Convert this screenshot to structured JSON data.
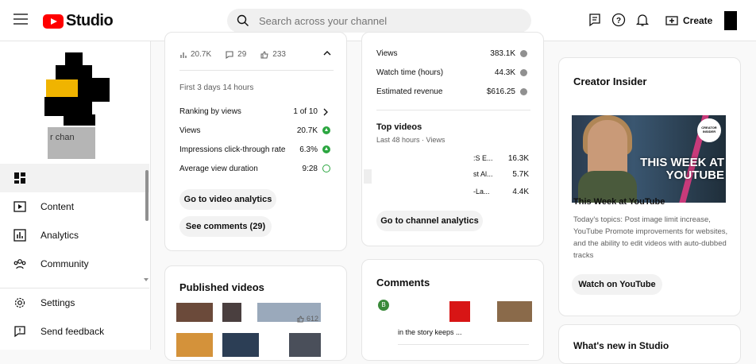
{
  "header": {
    "brand": "Studio",
    "search_placeholder": "Search across your channel",
    "create_label": "Create"
  },
  "sidebar": {
    "channel_name_fragment": "r chan",
    "items": [
      {
        "label": "",
        "icon": "dashboard-icon"
      },
      {
        "label": "Content",
        "icon": "content-icon"
      },
      {
        "label": "Analytics",
        "icon": "analytics-icon"
      },
      {
        "label": "Community",
        "icon": "community-icon"
      },
      {
        "label": "Settings",
        "icon": "gear-icon"
      },
      {
        "label": "Send feedback",
        "icon": "feedback-icon"
      }
    ]
  },
  "latest_video": {
    "views_count": "20.7K",
    "comments_count": "29",
    "likes_count": "233",
    "period": "First 3 days 14 hours",
    "metrics": [
      {
        "label": "Ranking by views",
        "value": "1 of 10"
      },
      {
        "label": "Views",
        "value": "20.7K"
      },
      {
        "label": "Impressions click-through rate",
        "value": "6.3%"
      },
      {
        "label": "Average view duration",
        "value": "9:28"
      }
    ],
    "analytics_button": "Go to video analytics",
    "comments_button": "See comments (29)"
  },
  "channel_analytics": {
    "metrics": [
      {
        "label": "Views",
        "value": "383.1K"
      },
      {
        "label": "Watch time (hours)",
        "value": "44.3K"
      },
      {
        "label": "Estimated revenue",
        "value": "$616.25"
      }
    ],
    "top_videos_title": "Top videos",
    "top_videos_period": "Last 48 hours · Views",
    "top_videos": [
      {
        "title": ":S E...",
        "views": "16.3K"
      },
      {
        "title": "st Al...",
        "views": "5.7K"
      },
      {
        "title": "-La...",
        "views": "4.4K"
      }
    ],
    "button": "Go to channel analytics"
  },
  "creator_insider": {
    "title": "Creator Insider",
    "thumb_badge": "CREATOR INSIDER",
    "thumb_headline": "THIS WEEK AT YOUTUBE",
    "video_title": "This Week at YouTube",
    "description": "Today's topics: Post image limit increase, YouTube Promote improvements for websites, and the ability to edit videos with auto-dubbed tracks",
    "button": "Watch on YouTube"
  },
  "published_videos": {
    "title": "Published videos",
    "likes_fragment": "612"
  },
  "comments": {
    "title": "Comments",
    "avatar_letter": "B",
    "comment_fragment": "in the story keeps ..."
  },
  "whats_new": {
    "title": "What's new in Studio"
  },
  "colors": {
    "brand_red": "#ff0000",
    "positive_green": "#2ba640"
  }
}
